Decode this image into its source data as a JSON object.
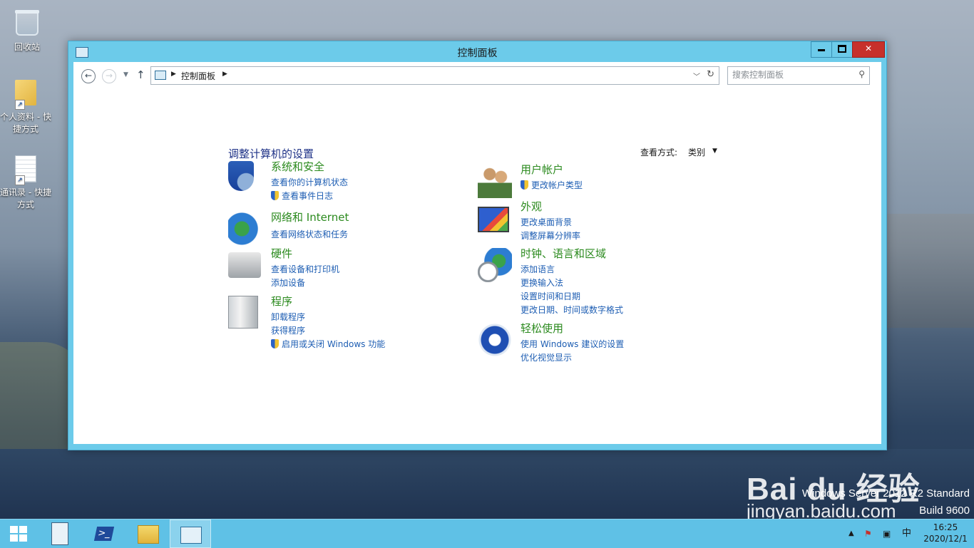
{
  "desktop": {
    "icons": [
      {
        "label": "回收站"
      },
      {
        "label": "个人资料 - 快捷方式"
      },
      {
        "label": "通讯录 - 快捷方式"
      }
    ],
    "watermark": {
      "brand": "Bai du 经验",
      "url": "jingyan.baidu.com"
    },
    "os_edition": "Windows Server 2012 R2 Standard",
    "os_build": "Build 9600"
  },
  "window": {
    "title": "控制面板",
    "controls": {
      "minimize": "—",
      "maximize": "□",
      "close": "✕"
    },
    "address": {
      "crumb": "控制面板"
    },
    "search": {
      "placeholder": "搜索控制面板"
    },
    "heading": "调整计算机的设置",
    "view_by": {
      "label": "查看方式:",
      "value": "类别"
    },
    "categories_left": [
      {
        "title": "系统和安全",
        "icon": "security-shield-icon",
        "links": [
          {
            "text": "查看你的计算机状态",
            "shield": false
          },
          {
            "text": "查看事件日志",
            "shield": true
          }
        ]
      },
      {
        "title": "网络和 Internet",
        "icon": "network-globe-icon",
        "links": [
          {
            "text": "查看网络状态和任务",
            "shield": false
          }
        ]
      },
      {
        "title": "硬件",
        "icon": "printer-icon",
        "links": [
          {
            "text": "查看设备和打印机",
            "shield": false
          },
          {
            "text": "添加设备",
            "shield": false
          }
        ]
      },
      {
        "title": "程序",
        "icon": "programs-box-icon",
        "links": [
          {
            "text": "卸载程序",
            "shield": false
          },
          {
            "text": "获得程序",
            "shield": false
          },
          {
            "text": "启用或关闭 Windows 功能",
            "shield": true
          }
        ]
      }
    ],
    "categories_right": [
      {
        "title": "用户帐户",
        "icon": "users-icon",
        "links": [
          {
            "text": "更改帐户类型",
            "shield": true
          }
        ]
      },
      {
        "title": "外观",
        "icon": "appearance-monitor-icon",
        "links": [
          {
            "text": "更改桌面背景",
            "shield": false
          },
          {
            "text": "调整屏幕分辨率",
            "shield": false
          }
        ]
      },
      {
        "title": "时钟、语言和区域",
        "icon": "clock-globe-icon",
        "links": [
          {
            "text": "添加语言",
            "shield": false
          },
          {
            "text": "更换输入法",
            "shield": false
          },
          {
            "text": "设置时间和日期",
            "shield": false
          },
          {
            "text": "更改日期、时间或数字格式",
            "shield": false
          }
        ]
      },
      {
        "title": "轻松使用",
        "icon": "ease-of-access-icon",
        "links": [
          {
            "text": "使用 Windows 建议的设置",
            "shield": false
          },
          {
            "text": "优化视觉显示",
            "shield": false
          }
        ]
      }
    ]
  },
  "taskbar": {
    "apps": [
      {
        "name": "start"
      },
      {
        "name": "server-manager"
      },
      {
        "name": "powershell"
      },
      {
        "name": "file-explorer"
      },
      {
        "name": "control-panel",
        "active": true
      }
    ],
    "tray": {
      "ime": "中",
      "time": "16:25",
      "date": "2020/12/1"
    }
  },
  "colors": {
    "accent": "#6ccbea",
    "link": "#1e5eb3",
    "category": "#2b8a1e",
    "heading": "#1e3287",
    "close": "#c7302b"
  }
}
